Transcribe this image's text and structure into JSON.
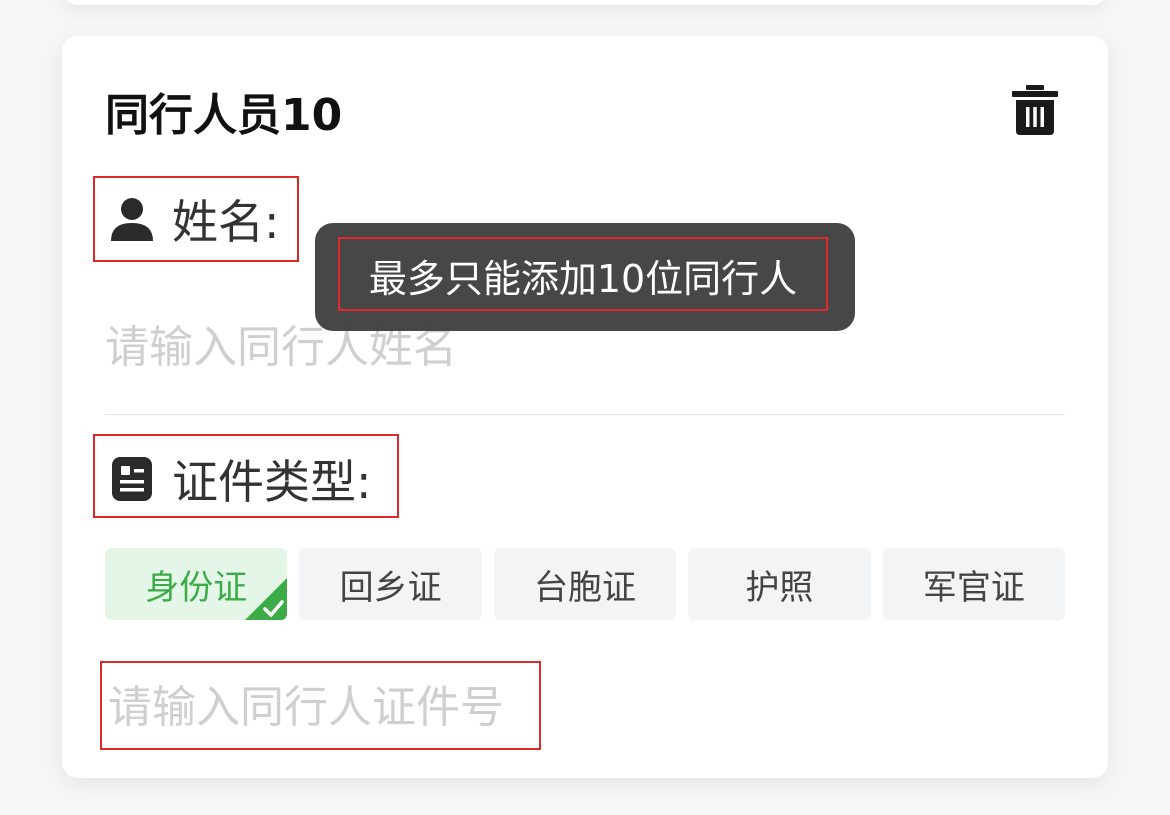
{
  "card": {
    "title": "同行人员10",
    "delete_icon": "trash-icon"
  },
  "name_field": {
    "icon": "person-icon",
    "label": "姓名:",
    "placeholder": "请输入同行人姓名",
    "value": ""
  },
  "id_type_field": {
    "icon": "id-card-icon",
    "label": "证件类型:",
    "options": [
      {
        "label": "身份证",
        "selected": true
      },
      {
        "label": "回乡证",
        "selected": false
      },
      {
        "label": "台胞证",
        "selected": false
      },
      {
        "label": "护照",
        "selected": false
      },
      {
        "label": "军官证",
        "selected": false
      }
    ],
    "selected_icon": "check-corner-icon"
  },
  "id_number_field": {
    "placeholder": "请输入同行人证件号",
    "value": ""
  },
  "toast": {
    "message": "最多只能添加10位同行人"
  },
  "colors": {
    "accent_green": "#3cab48",
    "selected_bg": "#e4f6e7",
    "highlight_red": "#e0292b",
    "toast_bg": "#404040"
  }
}
